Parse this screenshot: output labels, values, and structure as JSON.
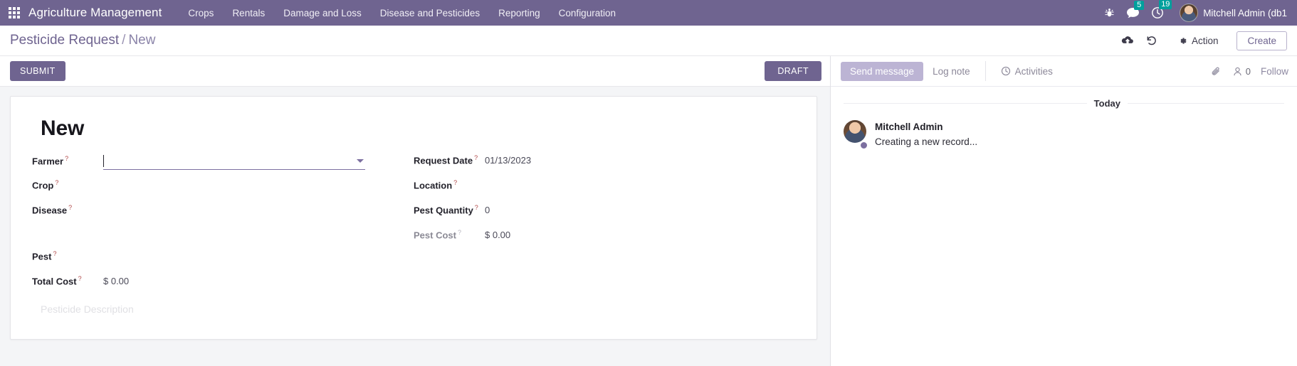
{
  "navbar": {
    "apps_icon": "apps-grid-icon",
    "brand": "Agriculture Management",
    "menus": [
      {
        "label": "Crops"
      },
      {
        "label": "Rentals"
      },
      {
        "label": "Damage and Loss"
      },
      {
        "label": "Disease and Pesticides"
      },
      {
        "label": "Reporting"
      },
      {
        "label": "Configuration"
      }
    ],
    "systray": {
      "debug_icon": "bug-icon",
      "messages_icon": "chat-bubble-icon",
      "messages_count": "5",
      "activities_icon": "clock-icon",
      "activities_count": "19",
      "avatar_icon": "user-avatar",
      "user_name": "Mitchell Admin (db1"
    },
    "colors": {
      "navbar_bg": "#6f6490",
      "badge_bg": "#00a09d",
      "accent": "#6f6490"
    }
  },
  "control_panel": {
    "breadcrumb_root": "Pesticide Request",
    "breadcrumb_sep": "/",
    "breadcrumb_current": "New",
    "save_icon": "cloud-upload-icon",
    "discard_icon": "undo-icon",
    "action_icon": "gear-icon",
    "action_label": "Action",
    "create_label": "Create"
  },
  "statusbar": {
    "submit_label": "SUBMIT",
    "state_label": "DRAFT"
  },
  "form": {
    "record_title": "New",
    "description_placeholder": "Pesticide Description",
    "left_fields": [
      {
        "label": "Farmer",
        "tip": "?",
        "value": "",
        "type": "many2one",
        "input_placeholder": ""
      },
      {
        "label": "Crop",
        "tip": "?",
        "value": "",
        "type": "many2one"
      },
      {
        "label": "Disease",
        "tip": "?",
        "value": "",
        "type": "many2one"
      },
      {
        "label": "Pest",
        "tip": "?",
        "value": "",
        "type": "many2one"
      },
      {
        "label": "Total Cost",
        "tip": "?",
        "value": "$ 0.00",
        "type": "monetary",
        "readonly": true
      }
    ],
    "right_fields": [
      {
        "label": "Request Date",
        "tip": "?",
        "value": "01/13/2023",
        "type": "date"
      },
      {
        "label": "Location",
        "tip": "?",
        "value": "",
        "type": "char"
      },
      {
        "label": "Pest Quantity",
        "tip": "?",
        "value": "0",
        "type": "integer"
      },
      {
        "label": "Pest Cost",
        "tip": "?",
        "value": "$ 0.00",
        "type": "monetary",
        "readonly": true
      }
    ]
  },
  "chatter": {
    "send_message_label": "Send message",
    "log_note_label": "Log note",
    "activities_label": "Activities",
    "activities_icon": "clock-icon",
    "attachment_icon": "paperclip-icon",
    "followers_icon": "user-icon",
    "followers_count": "0",
    "follow_label": "Follow",
    "date_separator": "Today",
    "messages": [
      {
        "author": "Mitchell Admin",
        "body": "Creating a new record...",
        "avatar_icon": "user-avatar",
        "status": "online"
      }
    ]
  }
}
